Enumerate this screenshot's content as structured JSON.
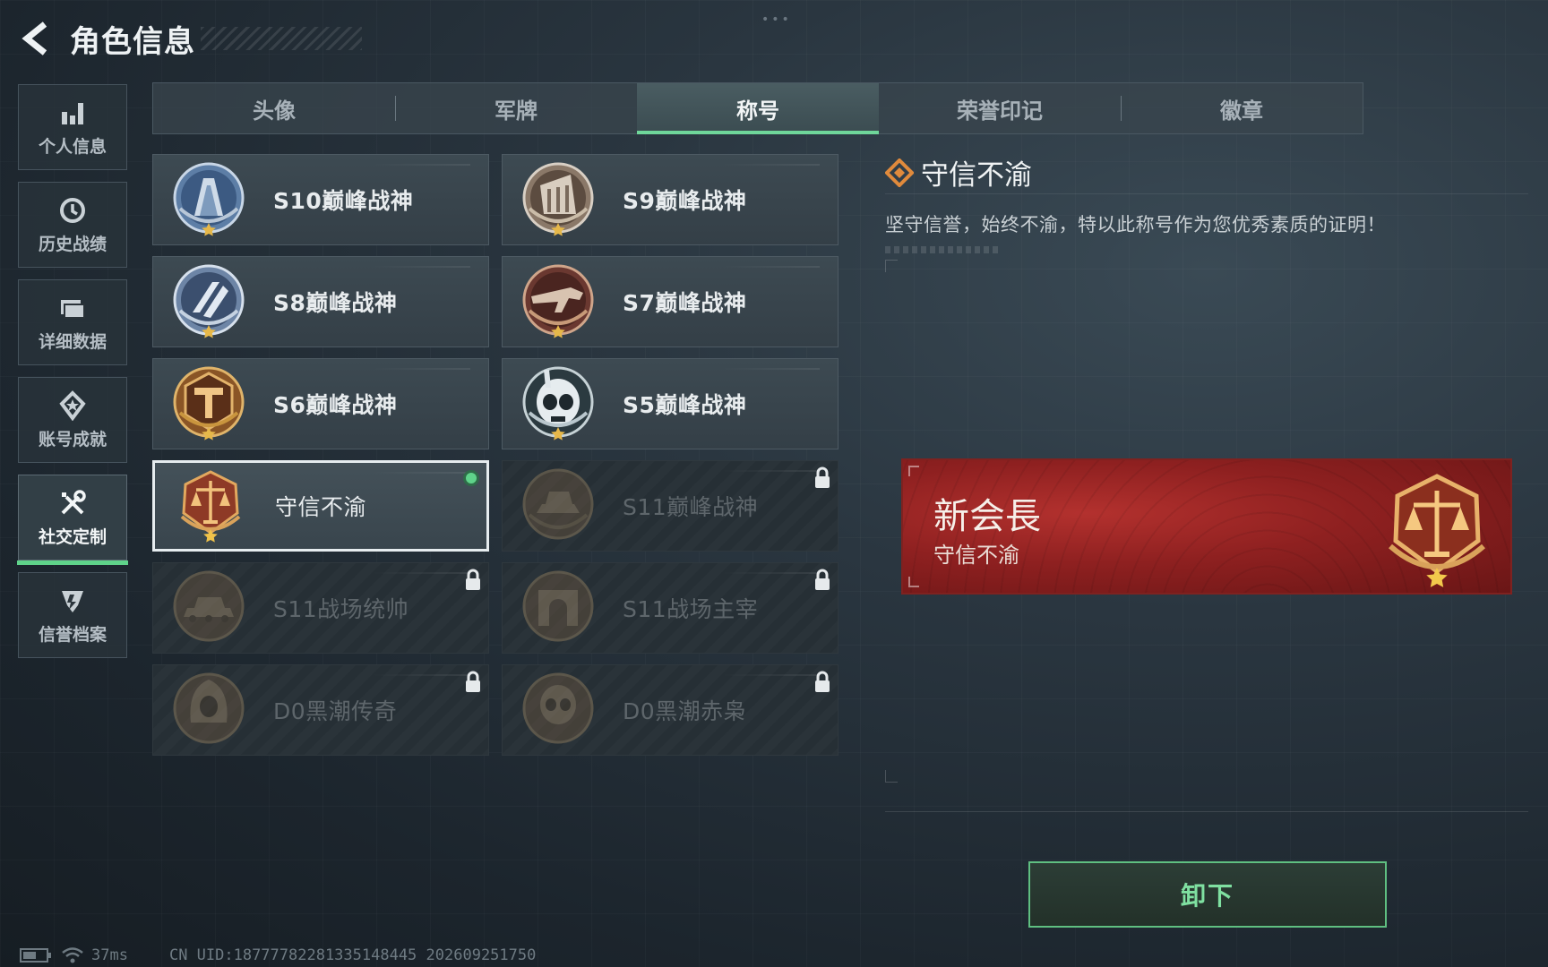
{
  "header": {
    "title": "角色信息"
  },
  "sidebar": {
    "items": [
      {
        "label": "个人信息",
        "icon": "bar-chart-icon",
        "active": false
      },
      {
        "label": "历史战绩",
        "icon": "clock-icon",
        "active": false
      },
      {
        "label": "详细数据",
        "icon": "folder-icon",
        "active": false
      },
      {
        "label": "账号成就",
        "icon": "achievement-icon",
        "active": false
      },
      {
        "label": "社交定制",
        "icon": "tools-icon",
        "active": true
      },
      {
        "label": "信誉档案",
        "icon": "shield-icon",
        "active": false
      }
    ]
  },
  "tabs": [
    {
      "label": "头像",
      "active": false
    },
    {
      "label": "军牌",
      "active": false
    },
    {
      "label": "称号",
      "active": true
    },
    {
      "label": "荣誉印记",
      "active": false
    },
    {
      "label": "徽章",
      "active": false
    }
  ],
  "titles": [
    {
      "label": "S10巅峰战神",
      "state": "unlocked",
      "medal": "s10-medal-icon"
    },
    {
      "label": "S9巅峰战神",
      "state": "unlocked",
      "medal": "s9-medal-icon"
    },
    {
      "label": "S8巅峰战神",
      "state": "unlocked",
      "medal": "s8-medal-icon"
    },
    {
      "label": "S7巅峰战神",
      "state": "unlocked",
      "medal": "s7-medal-icon"
    },
    {
      "label": "S6巅峰战神",
      "state": "unlocked",
      "medal": "s6-medal-icon"
    },
    {
      "label": "S5巅峰战神",
      "state": "unlocked",
      "medal": "s5-medal-icon"
    },
    {
      "label": "守信不渝",
      "state": "selected",
      "medal": "scales-medal-icon"
    },
    {
      "label": "S11巅峰战神",
      "state": "locked",
      "medal": "s11-medal-icon"
    },
    {
      "label": "S11战场统帅",
      "state": "locked",
      "medal": "tank-medal-icon"
    },
    {
      "label": "S11战场主宰",
      "state": "locked",
      "medal": "arch-medal-icon"
    },
    {
      "label": "D0黑潮传奇",
      "state": "locked",
      "medal": "hooded-medal-icon"
    },
    {
      "label": "D0黑潮赤枭",
      "state": "locked",
      "medal": "skull-medal-icon"
    }
  ],
  "detail": {
    "title": "守信不渝",
    "description": "坚守信誉，始终不渝，特以此称号作为您优秀素质的证明！"
  },
  "preview": {
    "player_name": "新会長",
    "title": "守信不渝"
  },
  "actions": {
    "unequip_label": "卸下"
  },
  "status": {
    "ping": "37ms",
    "uid": "CN UID:18777782281335148445 202609251750"
  },
  "colors": {
    "accent_green": "#5fd38a",
    "plate_red": "#8e2020",
    "medal_bronze": "#b0773a"
  }
}
